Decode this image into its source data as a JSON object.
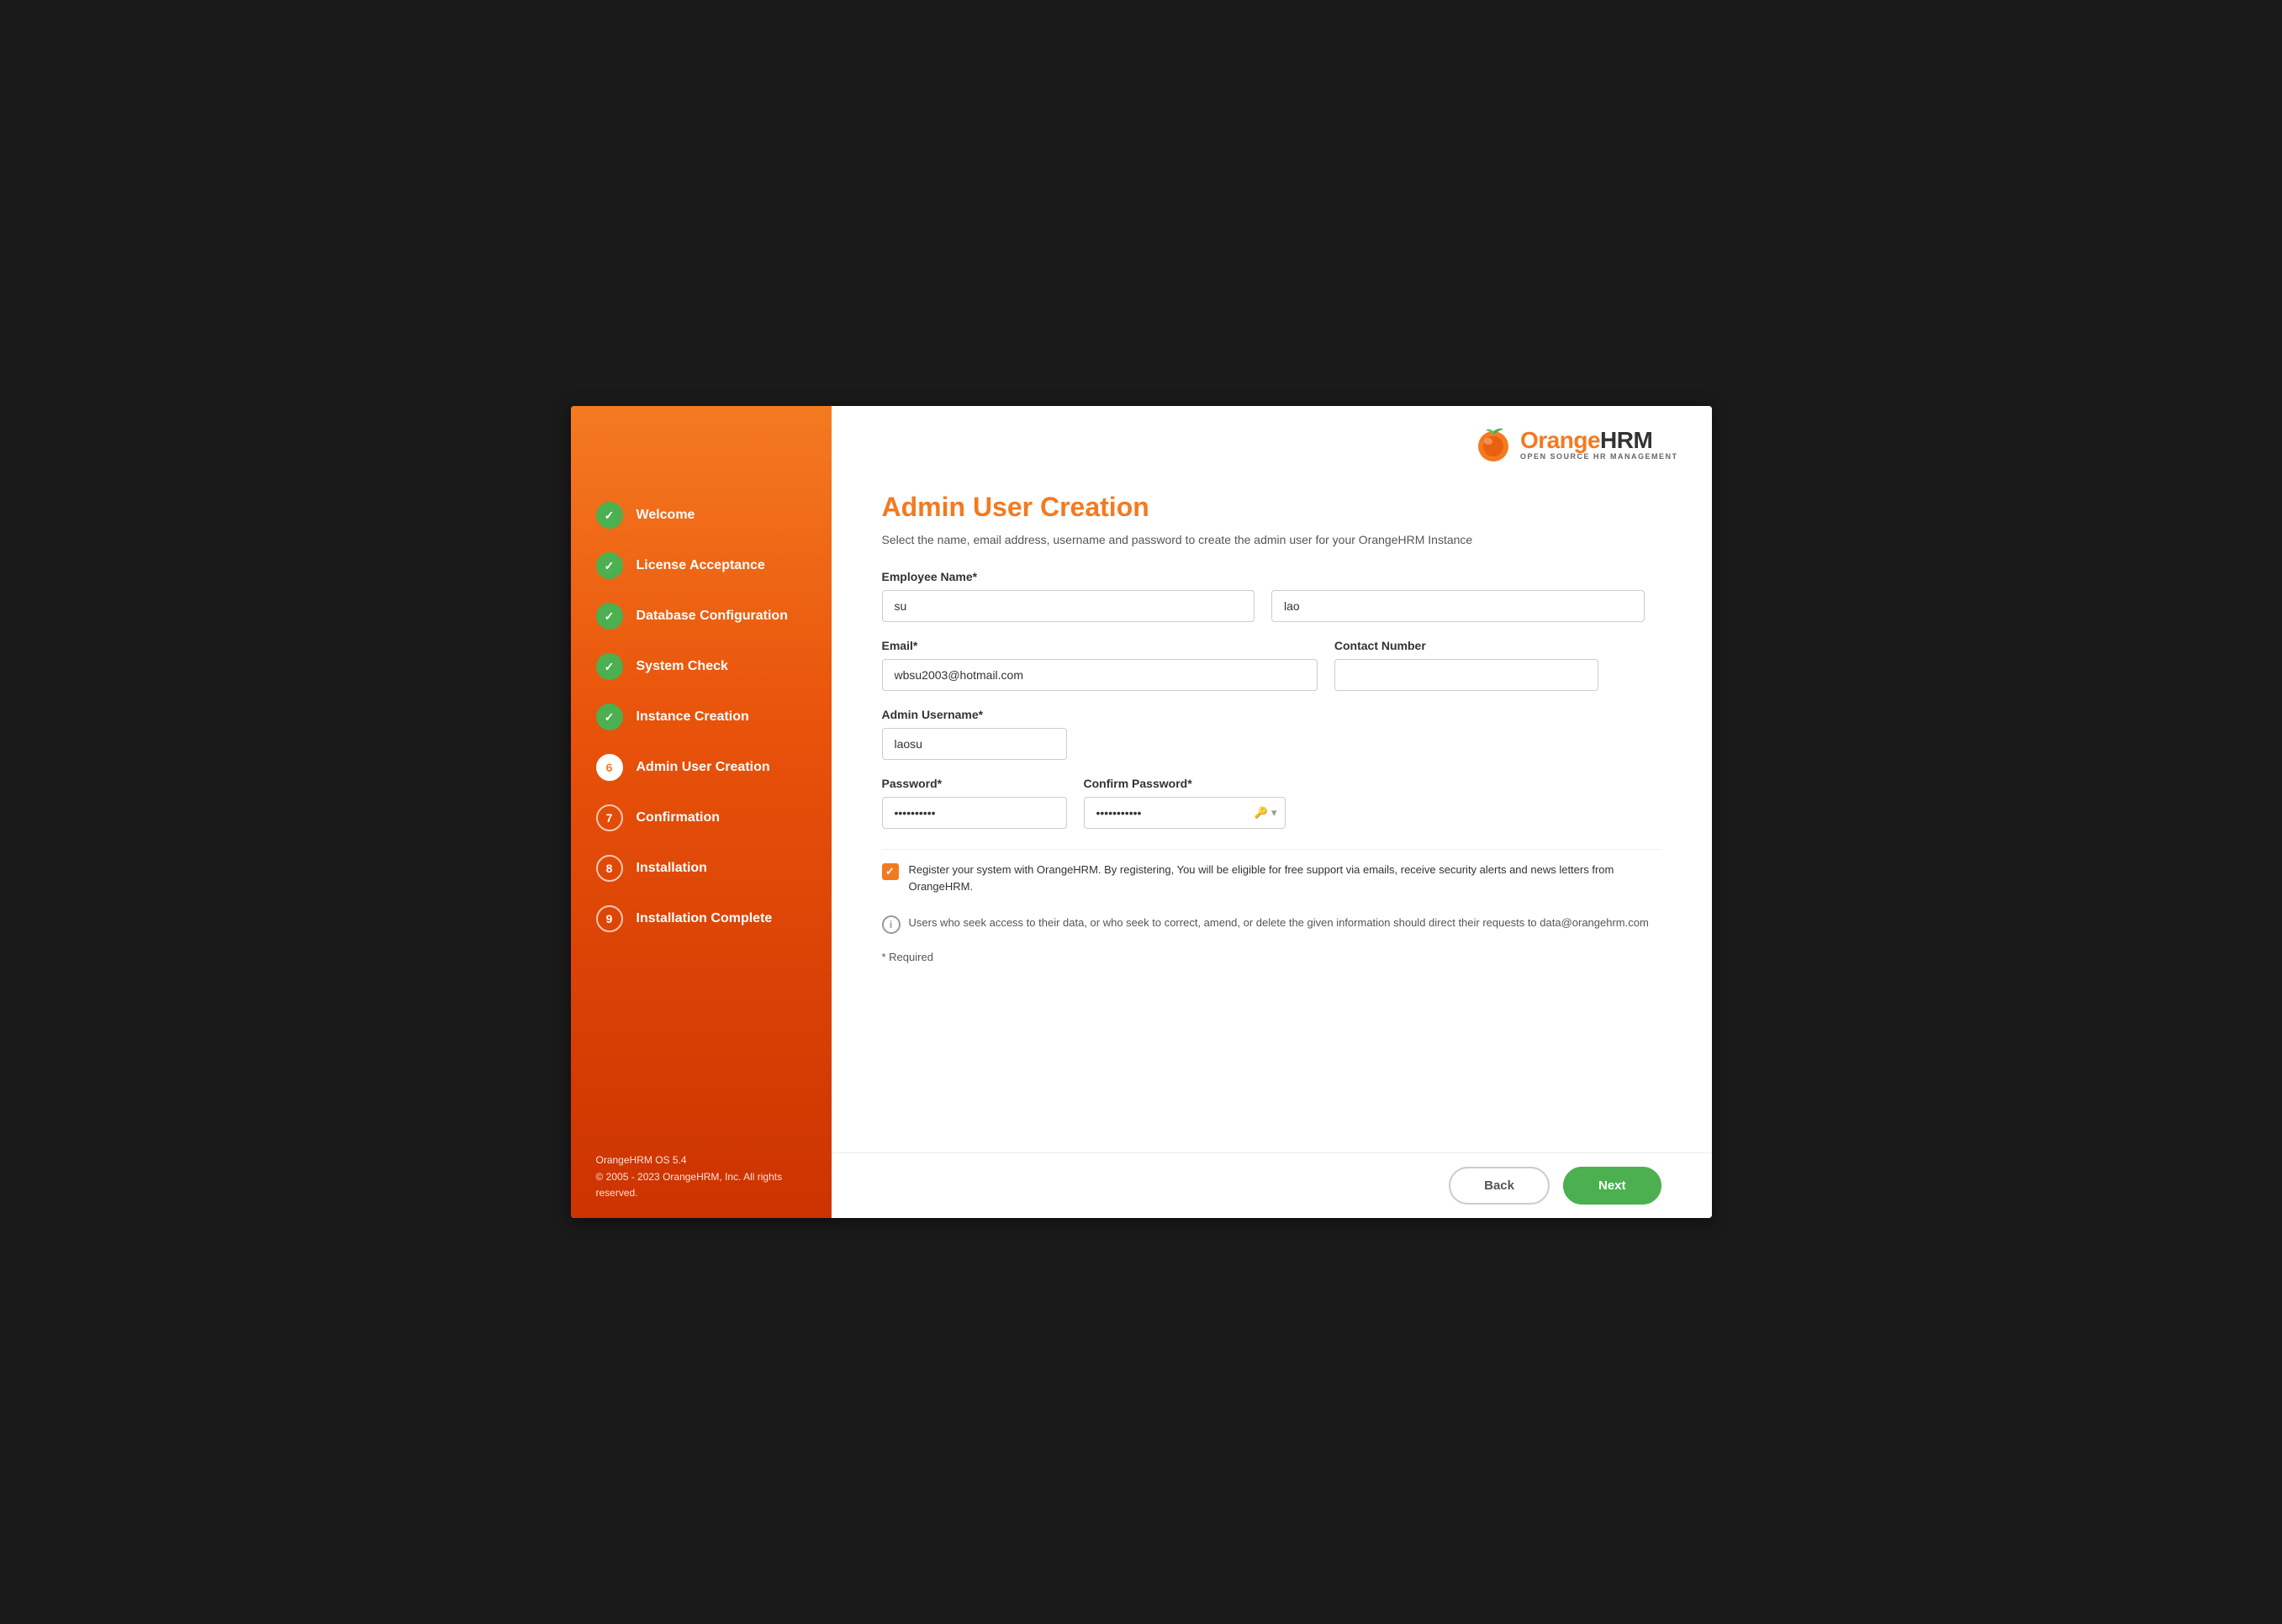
{
  "sidebar": {
    "steps": [
      {
        "id": 1,
        "label": "Welcome",
        "status": "completed"
      },
      {
        "id": 2,
        "label": "License Acceptance",
        "status": "completed"
      },
      {
        "id": 3,
        "label": "Database Configuration",
        "status": "completed"
      },
      {
        "id": 4,
        "label": "System Check",
        "status": "completed"
      },
      {
        "id": 5,
        "label": "Instance Creation",
        "status": "completed"
      },
      {
        "id": 6,
        "label": "Admin User Creation",
        "status": "active"
      },
      {
        "id": 7,
        "label": "Confirmation",
        "status": "pending"
      },
      {
        "id": 8,
        "label": "Installation",
        "status": "pending"
      },
      {
        "id": 9,
        "label": "Installation Complete",
        "status": "pending"
      }
    ],
    "footer": {
      "line1": "OrangeHRM OS 5.4",
      "line2": "© 2005 - 2023 OrangeHRM, Inc. All rights reserved."
    }
  },
  "logo": {
    "orange_part": "Orange",
    "dark_part": "HRM",
    "sub": "OPEN SOURCE HR MANAGEMENT"
  },
  "page": {
    "title": "Admin User Creation",
    "subtitle": "Select the name, email address, username and password to create the admin user for your OrangeHRM Instance"
  },
  "form": {
    "employee_name_label": "Employee Name*",
    "first_name_placeholder": "",
    "first_name_value": "su",
    "last_name_placeholder": "",
    "last_name_value": "lao",
    "email_label": "Email*",
    "email_value": "wbsu2003@hotmail.com",
    "contact_number_label": "Contact Number",
    "contact_number_value": "",
    "admin_username_label": "Admin Username*",
    "admin_username_value": "laosu",
    "password_label": "Password*",
    "password_value": "••••••••••",
    "confirm_password_label": "Confirm Password*",
    "confirm_password_value": "•••••••••••",
    "register_checkbox_text": "Register your system with OrangeHRM. By registering, You will be eligible for free support via emails, receive security alerts and news letters from OrangeHRM.",
    "info_text": "Users who seek access to their data, or who seek to correct, amend, or delete the given information should direct their requests to data@orangehrm.com",
    "required_note": "* Required"
  },
  "buttons": {
    "back": "Back",
    "next": "Next"
  }
}
